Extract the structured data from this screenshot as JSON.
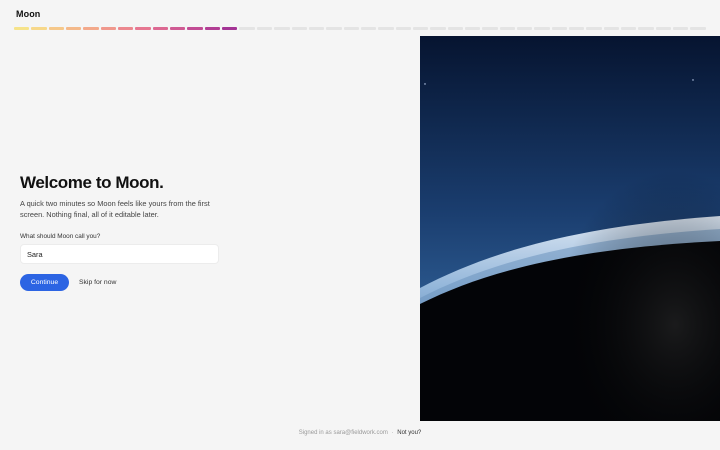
{
  "app": {
    "name": "Moon"
  },
  "progress": {
    "total_steps": 40,
    "completed_steps": 13,
    "colors": [
      "#f6e38a",
      "#f7d88a",
      "#f6c88a",
      "#f4b98a",
      "#f3a98b",
      "#f0988d",
      "#ec888f",
      "#e67791",
      "#dc6892",
      "#cf5a93",
      "#c24c94",
      "#b23e94",
      "#a43495"
    ],
    "empty_color": "#e4e4e4"
  },
  "onboarding": {
    "title": "Welcome to Moon.",
    "subtitle": "A quick two minutes so Moon feels like yours from the first screen. Nothing final, all of it editable later.",
    "name_label": "What should Moon call you?",
    "name_value": "Sara",
    "continue_label": "Continue",
    "skip_label": "Skip for now"
  },
  "footer": {
    "signed_in_text": "Signed in as sara@fieldwork.com",
    "separator": "·",
    "not_you_label": "Not you?"
  },
  "colors": {
    "accent": "#2c64e3",
    "background": "#f5f5f5"
  },
  "hero": {
    "subject": "earth-horizon-from-space"
  }
}
